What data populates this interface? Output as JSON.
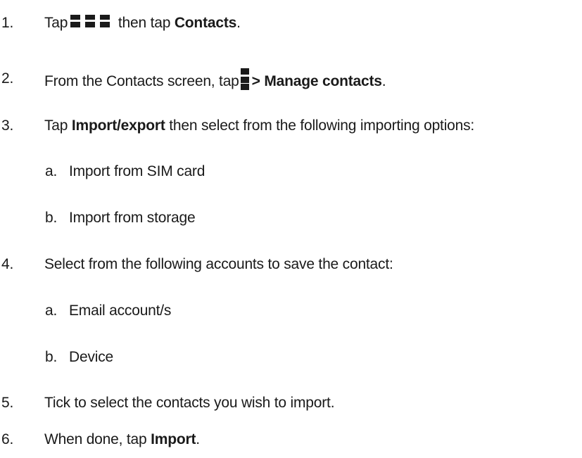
{
  "steps": [
    {
      "number": "1.",
      "before_icon": "Tap",
      "icon": "apps-grid-icon",
      "after_icon": " then tap ",
      "bold": "Contacts",
      "end": "."
    },
    {
      "number": "2.",
      "before_icon": "From the Contacts screen, tap",
      "icon": "menu-icon",
      "bold": "> Manage contacts",
      "end": "."
    },
    {
      "number": "3.",
      "before_bold": "Tap ",
      "bold": "Import/export",
      "after_bold": " then select from the following importing options:",
      "subitems": [
        {
          "letter": "a.",
          "text": "Import from SIM card"
        },
        {
          "letter": "b.",
          "text": "Import from storage"
        }
      ]
    },
    {
      "number": "4.",
      "text": "Select from the following accounts to save the contact:",
      "subitems": [
        {
          "letter": "a.",
          "text": "Email account/s"
        },
        {
          "letter": "b.",
          "text": "Device"
        }
      ]
    },
    {
      "number": "5.",
      "text": "Tick to select the contacts you wish to import."
    },
    {
      "number": "6.",
      "before_bold": "When done, tap ",
      "bold": "Import",
      "end": "."
    }
  ]
}
